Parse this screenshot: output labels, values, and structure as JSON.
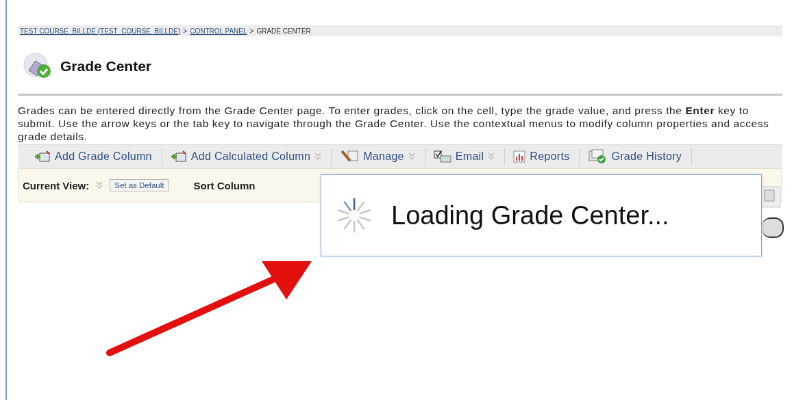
{
  "breadcrumb": {
    "links": [
      "TEST COURSE_BILLDE (TEST_COURSE_BILLDE)",
      "CONTROL PANEL"
    ],
    "separators": [
      ">",
      ">"
    ],
    "current": "GRADE CENTER"
  },
  "page_title": "Grade Center",
  "instructions": "Grades can be entered directly from the Grade Center page. To enter grades, click on the cell, type the grade value, and press the **Enter** key to submit. Use the arrow keys or the tab key to navigate through the Grade Center. Use the contextual menus to modify column properties and access grade details.",
  "toolbar": [
    {
      "label": "Add Grade Column",
      "kind": "add",
      "menu": false
    },
    {
      "label": "Add Calculated Column",
      "kind": "add",
      "menu": true
    },
    {
      "label": "Manage",
      "kind": "manage",
      "menu": true
    },
    {
      "label": "Email",
      "kind": "email",
      "menu": true
    },
    {
      "label": "Reports",
      "kind": "reports",
      "menu": false
    },
    {
      "label": "Grade History",
      "kind": "history",
      "menu": false
    }
  ],
  "filter_bar": {
    "current_view_label": "Current View:",
    "set_default_button": "Set as Default",
    "sort_label": "Sort Column"
  },
  "loading_dialog": {
    "message": "Loading Grade Center..."
  }
}
